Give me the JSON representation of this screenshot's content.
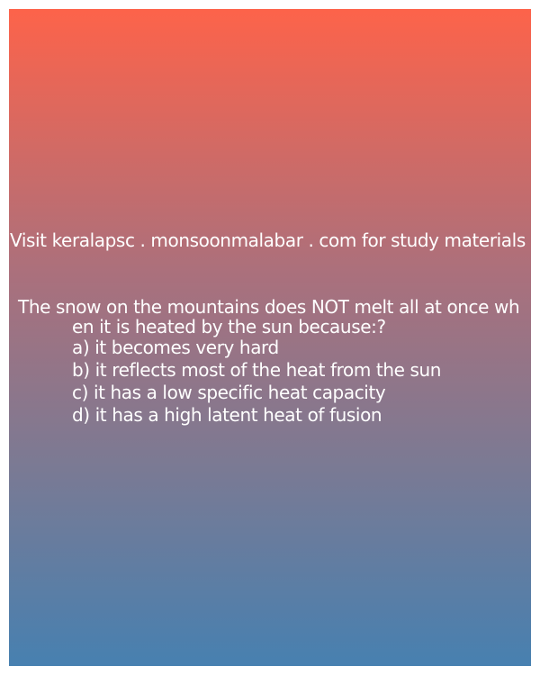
{
  "promo_text": "Visit keralapsc . monsoonmalabar . com for study materials",
  "question": {
    "text": "The snow on the mountains does NOT melt all at once when it is heated by the sun because:?",
    "options": [
      "a) it becomes very hard",
      "b) it reflects most of the heat from the sun",
      "c) it has a low specific heat capacity",
      "d) it has a high latent heat of fusion"
    ]
  },
  "colors": {
    "gradient_top": "#fd634a",
    "gradient_bottom": "#4780b0",
    "text": "#ffffff"
  }
}
